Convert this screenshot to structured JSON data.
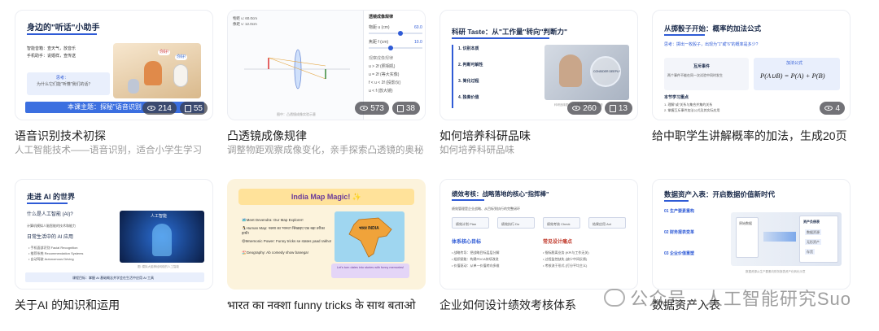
{
  "cards": [
    {
      "title": "语音识别技术初探",
      "subtitle": "人工智能技术——语音识别，适合小学生学习",
      "views": "214",
      "pages": "55",
      "slide": {
        "heading": "身边的\"听话\"小助手",
        "bullets": [
          "智能音箱：查天气，放音乐",
          "手机助手：说婚样，查传送"
        ],
        "question_label": "思考：",
        "question": "为什么它们能\"听懂\"我们的话？",
        "banner": "本课主题：探秘\"语音识别",
        "bubble1": "你好!",
        "bubble2": "你好!"
      }
    },
    {
      "title": "凸透镜成像规律",
      "subtitle": "调整物距观察成像变化，亲手探索凸透镜的奥秘",
      "views": "573",
      "pages": "38",
      "slide": {
        "panel_title": "透镜成像规律",
        "params": [
          "物距 u (cm)",
          "焦距 f (cm)"
        ],
        "param_values": [
          "60.0",
          "10.0"
        ],
        "section": "观察成像规律",
        "options": [
          "u > 2f (照相机)",
          "u = 2f (等大实像)",
          "f < u < 2f (投影仪)",
          "u < f (放大镜)"
        ],
        "readout_a": "物距 u: 60.0cm",
        "readout_b": "像距 v: 12.0cm",
        "caption": "图中：凸透镜成像实验示意"
      }
    },
    {
      "title": "如何培养科研品味",
      "subtitle": "如何培养科研品味",
      "views": "260",
      "pages": "13",
      "slide": {
        "heading": "科研 Taste：从\"工作量\"转向\"判断力\"",
        "items": [
          "1. 识别本质",
          "2. 判断可解性",
          "3. 简化过程",
          "4. 独奏价值"
        ],
        "badge": "CONSIDER DEEPLY",
        "caption": "科研品味图：以深度思考替代盲目试错"
      }
    },
    {
      "title": "给中职学生讲解概率的加法，生成20页",
      "subtitle": "",
      "views": "4",
      "pages": "",
      "slide": {
        "heading": "从掷骰子开始：概率的加法公式",
        "question": "思考：掷出一枚骰子，出现为\"1\"或\"6\"的概率是多少?",
        "left_box_title": "互斥事件",
        "left_box_text": "两个事件不能在同一次试验中同时发生",
        "right_box_title": "加法公式",
        "formula": "P(A∪B) = P(A) + P(B)",
        "goals_label": "本节学习重点",
        "goals": [
          "1. 理解\"或\"关系与集合并集的关系",
          "2. 掌握互斥事件加法公式及其实际应用"
        ]
      }
    },
    {
      "title": "关于AI 的知识和运用",
      "subtitle": "",
      "views": "",
      "pages": "",
      "slide": {
        "heading": "走进 AI 的世界",
        "q1": "什么是人工智能 (AI)?",
        "q1_text": "计算机模拟人脑智能的技术和能力",
        "q2": "日常生活中的 AI 应用",
        "apps": [
          "• 手机面部识别 Facial Recognition",
          "• 推荐系统 Recommendation Systems",
          "• 自动驾驶 Autonomous Driving"
        ],
        "image_label": "人工智能",
        "image_caption": "图: 模拟大脑神经网络的人工智能",
        "footer": "课程目标：掌握 AI 基础概念并学会在生活中应用 AI 工具"
      }
    },
    {
      "title": "भारत का नक्शा funny tricks के साथ बताओ",
      "subtitle": "",
      "views": "",
      "pages": "",
      "slide": {
        "heading": "India Map Magic! ✨",
        "lines": [
          "🗺️Meet Devendra: Our Map Explorer!",
          "🐧Human Map: नक्शा का 'मानव'! सिखाइए एक बड़ा तरीका हाथी!",
          "😄Mnemonic Power: Funny tricks se states yaad rakho!",
          "🏖️Geography: Ab comedy show banega!"
        ],
        "map_label": "भारत INDIA",
        "note": "Let's turn dates into stories with funny memories!"
      }
    },
    {
      "title": "企业如何设计绩效考核体系",
      "subtitle": "",
      "views": "",
      "pages": "",
      "slide": {
        "heading": "绩效考核：战略落地的核心\"指挥棒\"",
        "intro": "绩效管理是企业战略、从目标到执行的完整闭环",
        "steps": [
          "绩效计划 Plan",
          "绩效执行 Do",
          "绩效考核 Check",
          "结果应用 Act"
        ],
        "left_title": "体系核心目标",
        "left_items": [
          "• 战略传导：把战略目标层层分解",
          "• 组织赋能：构建PDCA持续改进",
          "• 价值驱动：从单一价值转向多维"
        ],
        "right_title": "常见设计痛点",
        "right_items": [
          "• 指标脱离业务 (KPI与工作无关)",
          "• 过程监控缺失 (缺少中间反馈)",
          "• 考核流于形式 (打分平均主义)"
        ]
      }
    },
    {
      "title": "数据资产入表",
      "subtitle": "",
      "views": "",
      "pages": "",
      "slide": {
        "heading": "数据资产入表：开启数据价值新时代",
        "items": [
          "01 生产要素重构",
          "02 财务报表变革",
          "03 企业价值重塑"
        ],
        "diagram_left": "原始数据",
        "diagram_right": "资产负债表",
        "rows": [
          "数据资源",
          "无形资产",
          "存货"
        ],
        "caption": "数据资源从生产要素向财务报表资产化转化示意"
      }
    }
  ],
  "watermark": "公众号 · 人工智能研究Suo"
}
